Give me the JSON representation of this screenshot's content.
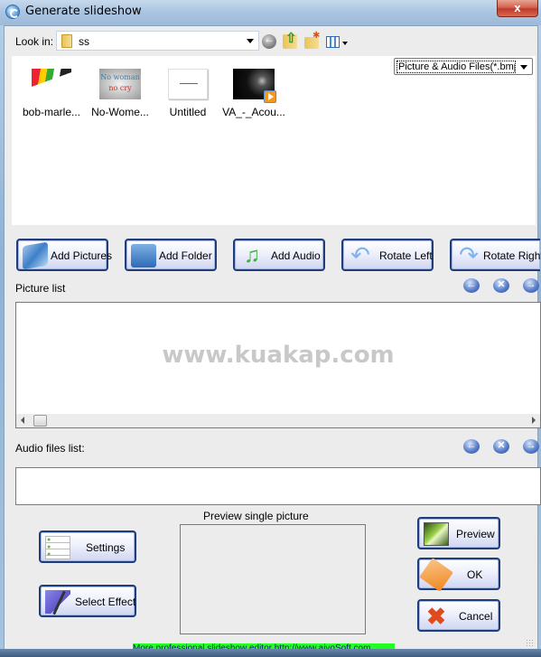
{
  "window": {
    "title": "Generate slideshow",
    "close_label": "x"
  },
  "lookin": {
    "label": "Look in:",
    "value": "ss"
  },
  "toolbar": {
    "icons": [
      "back-icon",
      "up-folder-icon",
      "new-folder-icon",
      "view-menu-icon"
    ]
  },
  "filter": {
    "value": "Picture & Audio Files(*.bmp;"
  },
  "files": [
    {
      "name": "bob-marle...",
      "type": "image"
    },
    {
      "name": "No-Wome...",
      "type": "image",
      "thumb_text_1": "No woman",
      "thumb_text_2": "no cry"
    },
    {
      "name": "Untitled",
      "type": "image"
    },
    {
      "name": "VA_-_Acou...",
      "type": "audio"
    }
  ],
  "buttons": {
    "add_pictures": "Add Pictures",
    "add_folder": "Add Folder",
    "add_audio": "Add Audio",
    "rotate_left": "Rotate Left",
    "rotate_right": "Rotate Right",
    "settings": "Settings",
    "select_effect": "Select Effect",
    "preview": "Preview",
    "ok": "OK",
    "cancel": "Cancel"
  },
  "picture_list": {
    "label": "Picture list",
    "watermark": "www.kuakap.com",
    "nav": {
      "up": "←",
      "delete": "✕",
      "down": "→"
    }
  },
  "audio_list": {
    "label": "Audio files list:",
    "nav": {
      "up": "←",
      "delete": "✕",
      "down": "→"
    }
  },
  "preview": {
    "label": "Preview single picture"
  },
  "footer": {
    "link_text": "More professional slideshow editor http://www.aiyoSoft.com"
  },
  "colors": {
    "button_border": "#1f3d7a",
    "link_bar": "#22ff22",
    "window_bg": "#ececec"
  }
}
